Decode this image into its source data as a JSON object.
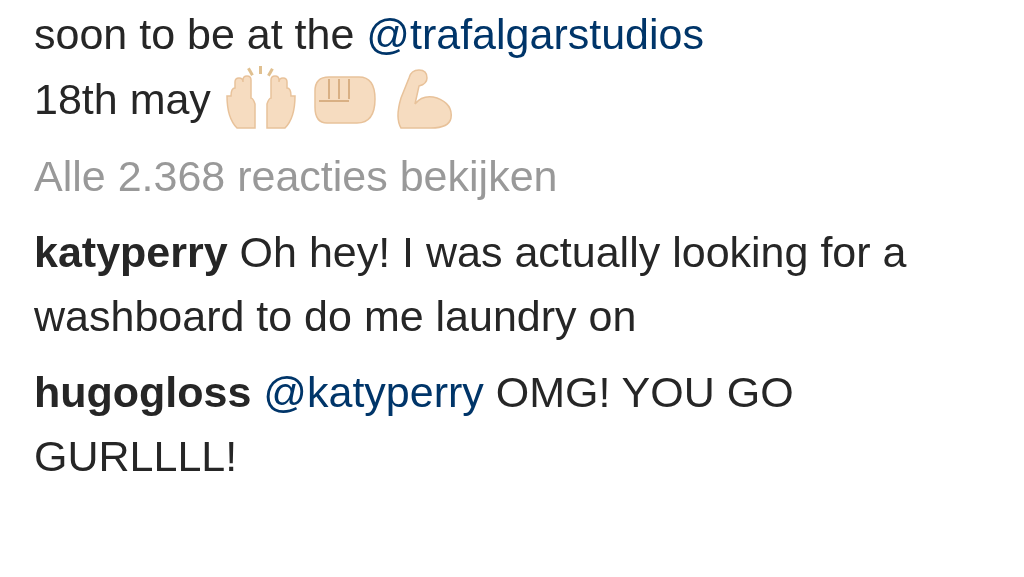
{
  "caption": {
    "lines": [
      [
        {
          "kind": "plain",
          "text": "soon to be at the "
        },
        {
          "kind": "mention",
          "text": "@trafalgarstudios"
        }
      ],
      [
        {
          "kind": "plain",
          "text": "18th may"
        }
      ]
    ]
  },
  "view_all": "Alle 2.368 reacties bekijken",
  "comments": [
    {
      "username": "katyperry",
      "segments": [
        {
          "kind": "plain",
          "text": "Oh hey! I was actually looking for a washboard to do me laundry on"
        }
      ]
    },
    {
      "username": "hugogloss",
      "segments": [
        {
          "kind": "mention",
          "text": "@katyperry"
        },
        {
          "kind": "plain",
          "text": " OMG! YOU GO GURLLLL!"
        }
      ]
    }
  ]
}
